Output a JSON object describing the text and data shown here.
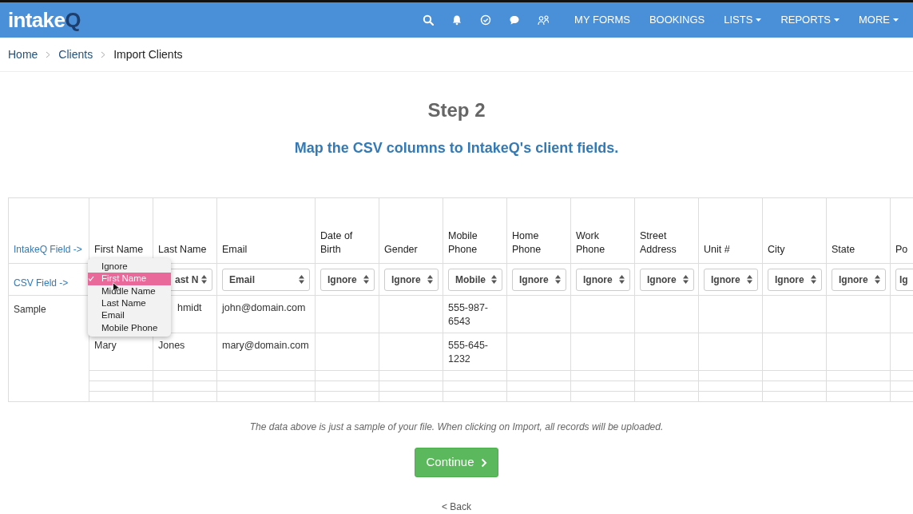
{
  "nav": {
    "logo": {
      "text": "intake",
      "accent": "Q"
    },
    "links": [
      {
        "label": "MY FORMS",
        "dropdown": false
      },
      {
        "label": "BOOKINGS",
        "dropdown": false
      },
      {
        "label": "LISTS",
        "dropdown": true
      },
      {
        "label": "REPORTS",
        "dropdown": true
      },
      {
        "label": "MORE",
        "dropdown": true
      }
    ]
  },
  "breadcrumb": [
    {
      "label": "Home",
      "link": true
    },
    {
      "label": "Clients",
      "link": true
    },
    {
      "label": "Import Clients",
      "link": false
    }
  ],
  "title": "Step 2",
  "subtitle": "Map the CSV columns to IntakeQ's client fields.",
  "table": {
    "header_label": "IntakeQ Field ->",
    "select_label": "CSV Field ->",
    "sample_label": "Sample",
    "columns": [
      {
        "header": "First Name"
      },
      {
        "header": "Last Name",
        "select": "ast N"
      },
      {
        "header": "Email",
        "select": "Email"
      },
      {
        "header": "Date of Birth",
        "select": "Ignore"
      },
      {
        "header": "Gender",
        "select": "Ignore"
      },
      {
        "header": "Mobile Phone",
        "select": "Mobile"
      },
      {
        "header": "Home Phone",
        "select": "Ignore"
      },
      {
        "header": "Work Phone",
        "select": "Ignore"
      },
      {
        "header": "Street Address",
        "select": "Ignore"
      },
      {
        "header": "Unit #",
        "select": "Ignore"
      },
      {
        "header": "City",
        "select": "Ignore"
      },
      {
        "header": "State",
        "select": "Ignore"
      },
      {
        "header": "Po",
        "select": "Ig"
      }
    ],
    "rows": [
      {
        "kind": "data",
        "cells": [
          null,
          "hmidt",
          "john@domain.com",
          null,
          null,
          "555-987-6543",
          null,
          null,
          null,
          null,
          null,
          null,
          null
        ]
      },
      {
        "kind": "data",
        "cells": [
          "Mary",
          "Jones",
          "mary@domain.com",
          null,
          null,
          "555-645-1232",
          null,
          null,
          null,
          null,
          null,
          null,
          null
        ]
      },
      {
        "kind": "blank"
      },
      {
        "kind": "blank"
      },
      {
        "kind": "blank"
      }
    ],
    "dropdown": [
      {
        "label": "Ignore",
        "selected": false
      },
      {
        "label": "First Name",
        "selected": true
      },
      {
        "label": "Middle Name",
        "selected": false
      },
      {
        "label": "Last Name",
        "selected": false
      },
      {
        "label": "Email",
        "selected": false
      },
      {
        "label": "Mobile Phone",
        "selected": false
      }
    ]
  },
  "note": "The data above is just a sample of your file. When clicking on Import, all records will be uploaded.",
  "continue": "Continue",
  "back": "< Back"
}
